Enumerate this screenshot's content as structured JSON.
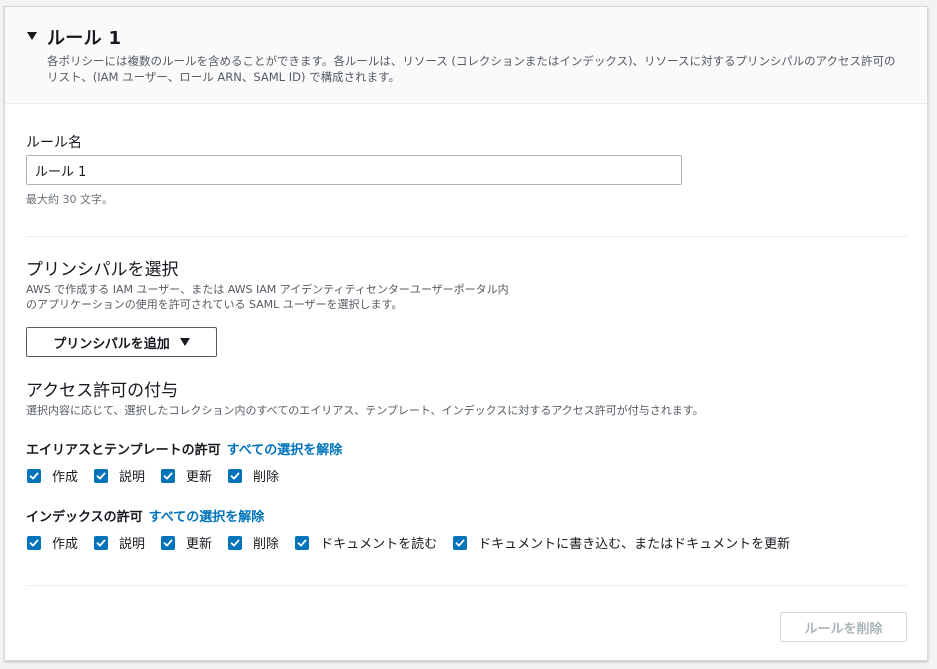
{
  "rule": {
    "title": "ルール 1",
    "description": "各ポリシーには複数のルールを含めることができます。各ルールは、リソース (コレクションまたはインデックス)、リソースに対するプリンシパルのアクセス許可のリスト、(IAM ユーザー、ロール ARN、SAML ID) で構成されます。"
  },
  "rule_name": {
    "label": "ルール名",
    "value": "ルール 1",
    "hint": "最大約 30 文字。"
  },
  "principal": {
    "title": "プリンシパルを選択",
    "description_line1": "AWS で作成する IAM ユーザー、または AWS IAM アイデンティティセンターユーザーポータル内",
    "description_line2": "のアプリケーションの使用を許可されている SAML ユーザーを選択します。",
    "add_button_label": "プリンシパルを追加"
  },
  "access": {
    "title": "アクセス許可の付与",
    "description": "選択内容に応じて、選択したコレクション内のすべてのエイリアス、テンプレート、インデックスに対するアクセス許可が付与されます。"
  },
  "alias_permissions": {
    "heading": "エイリアスとテンプレートの許可",
    "deselect_all": "すべての選択を解除",
    "options": [
      {
        "label": "作成",
        "checked": true
      },
      {
        "label": "説明",
        "checked": true
      },
      {
        "label": "更新",
        "checked": true
      },
      {
        "label": "削除",
        "checked": true
      }
    ]
  },
  "index_permissions": {
    "heading": "インデックスの許可",
    "deselect_all": "すべての選択を解除",
    "options": [
      {
        "label": "作成",
        "checked": true
      },
      {
        "label": "説明",
        "checked": true
      },
      {
        "label": "更新",
        "checked": true
      },
      {
        "label": "削除",
        "checked": true
      },
      {
        "label": "ドキュメントを読む",
        "checked": true
      },
      {
        "label": "ドキュメントに書き込む、またはドキュメントを更新",
        "checked": true
      }
    ]
  },
  "footer": {
    "delete_label": "ルールを削除"
  },
  "colors": {
    "accent": "#0073bb",
    "panel_header_bg": "#fafafa",
    "disabled_text": "#aab7b8"
  },
  "icons": {
    "collapse": "caret-down-icon",
    "dropdown": "caret-down-icon",
    "checkbox": "check-icon"
  }
}
